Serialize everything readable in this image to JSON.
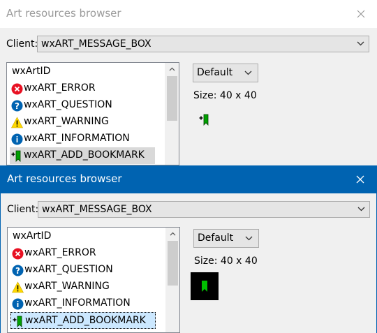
{
  "window1": {
    "title": "Art resources browser",
    "client_label": "Client:",
    "client_value": "wxART_MESSAGE_BOX",
    "list_header": "wxArtID",
    "items": [
      "wxART_ERROR",
      "wxART_QUESTION",
      "wxART_WARNING",
      "wxART_INFORMATION",
      "wxART_ADD_BOOKMARK"
    ],
    "selected_item": "wxART_ADD_BOOKMARK",
    "size_option": "Default",
    "size_text": "Size: 40 x 40"
  },
  "window2": {
    "title": "Art resources browser",
    "client_label": "Client:",
    "client_value": "wxART_MESSAGE_BOX",
    "list_header": "wxArtID",
    "items": [
      "wxART_ERROR",
      "wxART_QUESTION",
      "wxART_WARNING",
      "wxART_INFORMATION",
      "wxART_ADD_BOOKMARK"
    ],
    "selected_item": "wxART_ADD_BOOKMARK",
    "size_option": "Default",
    "size_text": "Size: 40 x 40"
  },
  "icons": {
    "error": "error-icon",
    "question": "question-icon",
    "warning": "warning-icon",
    "information": "information-icon",
    "add_bookmark": "add-bookmark-icon",
    "close": "close-icon",
    "dropdown": "chevron-down-icon"
  },
  "colors": {
    "active_titlebar": "#0063b1",
    "error": "#e81123",
    "question": "#0063b1",
    "warning": "#ffd800",
    "information": "#0063b1",
    "bookmark": "#00a000"
  }
}
